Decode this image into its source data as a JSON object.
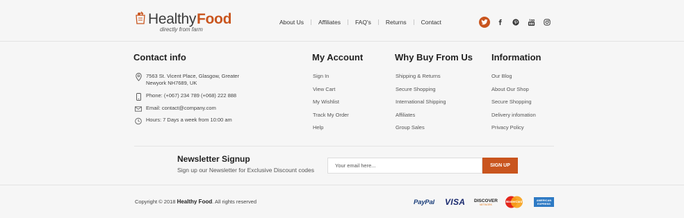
{
  "brand": {
    "name_part1": "Healthy",
    "name_part2": "Food",
    "tagline": "directly from farm",
    "accent_color": "#c9551e"
  },
  "nav": {
    "items": [
      "About Us",
      "Affiliates",
      "FAQ's",
      "Returns",
      "Contact"
    ]
  },
  "social": {
    "icons": [
      "twitter-icon",
      "facebook-icon",
      "pinterest-icon",
      "youtube-icon",
      "instagram-icon"
    ]
  },
  "contact": {
    "title": "Contact info",
    "address_line1": "7563 St. Vicent Place, Glasgow, Greater",
    "address_line2": "Newyork NH7689, UK",
    "phone": "Phone: (+067) 234 789  (+068) 222 888",
    "email": "Email:  contact@company.com",
    "hours": "Hours: 7 Days a week from 10:00 am"
  },
  "my_account": {
    "title": "My Account",
    "links": [
      "Sign In",
      "View Cart",
      "My Wishlist",
      "Track My Order",
      "Help"
    ]
  },
  "why_buy": {
    "title": "Why Buy From Us",
    "links": [
      "Shipping & Returns",
      "Secure Shopping",
      "International Shipping",
      "Affiliates",
      "Group Sales"
    ]
  },
  "information": {
    "title": "Information",
    "links": [
      "Our Blog",
      "About Our Shop",
      "Secure Shopping",
      "Delivery infomation",
      "Privacy Policy"
    ]
  },
  "newsletter": {
    "title": "Newsletter Signup",
    "subtitle": "Sign up our Newsletter for Exclusive Discount codes",
    "placeholder": "Your email here...",
    "button": "SIGN UP"
  },
  "footer": {
    "copyright_prefix": "Copyright © 2018 ",
    "copyright_brand": "Healthy Food",
    "copyright_suffix": ". All rights reserved"
  },
  "payments": {
    "paypal": "PayPal",
    "visa": "VISA",
    "discover": "DISCOVER",
    "discover_sub": "NETWORK",
    "mastercard": "MasterCard",
    "amex_line1": "AMERICAN",
    "amex_line2": "EXPRESS"
  }
}
